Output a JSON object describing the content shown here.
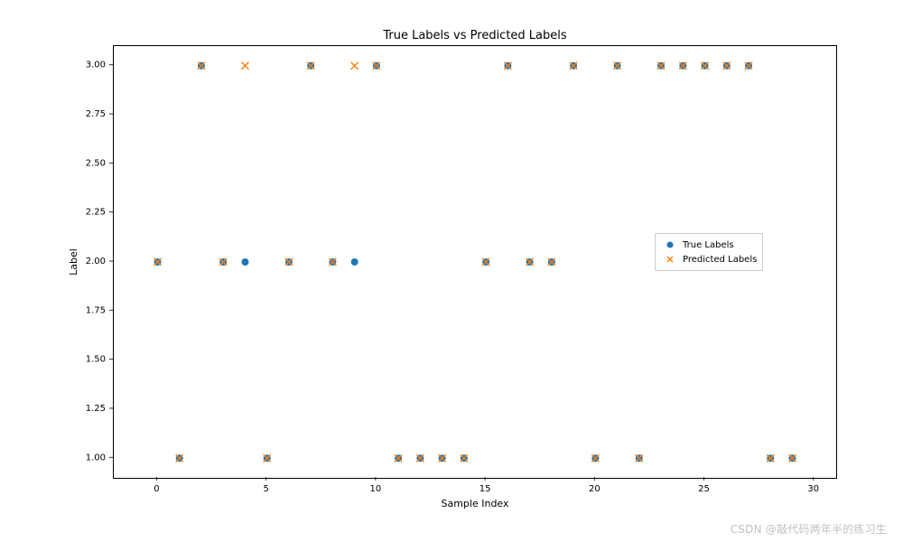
{
  "chart_data": {
    "type": "scatter",
    "title": "True Labels vs Predicted Labels",
    "xlabel": "Sample Index",
    "ylabel": "Label",
    "xlim": [
      -2,
      31
    ],
    "ylim": [
      0.9,
      3.1
    ],
    "xticks": [
      0,
      5,
      10,
      15,
      20,
      25,
      30
    ],
    "yticks": [
      1.0,
      1.25,
      1.5,
      1.75,
      2.0,
      2.25,
      2.5,
      2.75,
      3.0
    ],
    "ytick_labels": [
      "1.00",
      "1.25",
      "1.50",
      "1.75",
      "2.00",
      "2.25",
      "2.50",
      "2.75",
      "3.00"
    ],
    "series": [
      {
        "name": "True Labels",
        "marker": "circle",
        "color": "#1f77b4",
        "x": [
          0,
          1,
          2,
          3,
          4,
          5,
          6,
          7,
          8,
          9,
          10,
          11,
          12,
          13,
          14,
          15,
          16,
          17,
          18,
          19,
          20,
          21,
          22,
          23,
          24,
          25,
          26,
          27,
          28,
          29
        ],
        "y": [
          2,
          1,
          3,
          2,
          2,
          1,
          2,
          3,
          2,
          2,
          3,
          1,
          1,
          1,
          1,
          2,
          3,
          2,
          2,
          3,
          1,
          3,
          1,
          3,
          3,
          3,
          3,
          3,
          1,
          1
        ]
      },
      {
        "name": "Predicted Labels",
        "marker": "x",
        "color": "#ff7f0e",
        "x": [
          0,
          1,
          2,
          3,
          4,
          5,
          6,
          7,
          8,
          9,
          10,
          11,
          12,
          13,
          14,
          15,
          16,
          17,
          18,
          19,
          20,
          21,
          22,
          23,
          24,
          25,
          26,
          27,
          28,
          29
        ],
        "y": [
          2,
          1,
          3,
          2,
          3,
          1,
          2,
          3,
          2,
          3,
          3,
          1,
          1,
          1,
          1,
          2,
          3,
          2,
          2,
          3,
          1,
          3,
          1,
          3,
          3,
          3,
          3,
          3,
          1,
          1
        ]
      }
    ],
    "legend_position": "right"
  },
  "legend": {
    "items": [
      "True Labels",
      "Predicted Labels"
    ]
  },
  "watermark": "CSDN @敲代码两年半的练习生"
}
